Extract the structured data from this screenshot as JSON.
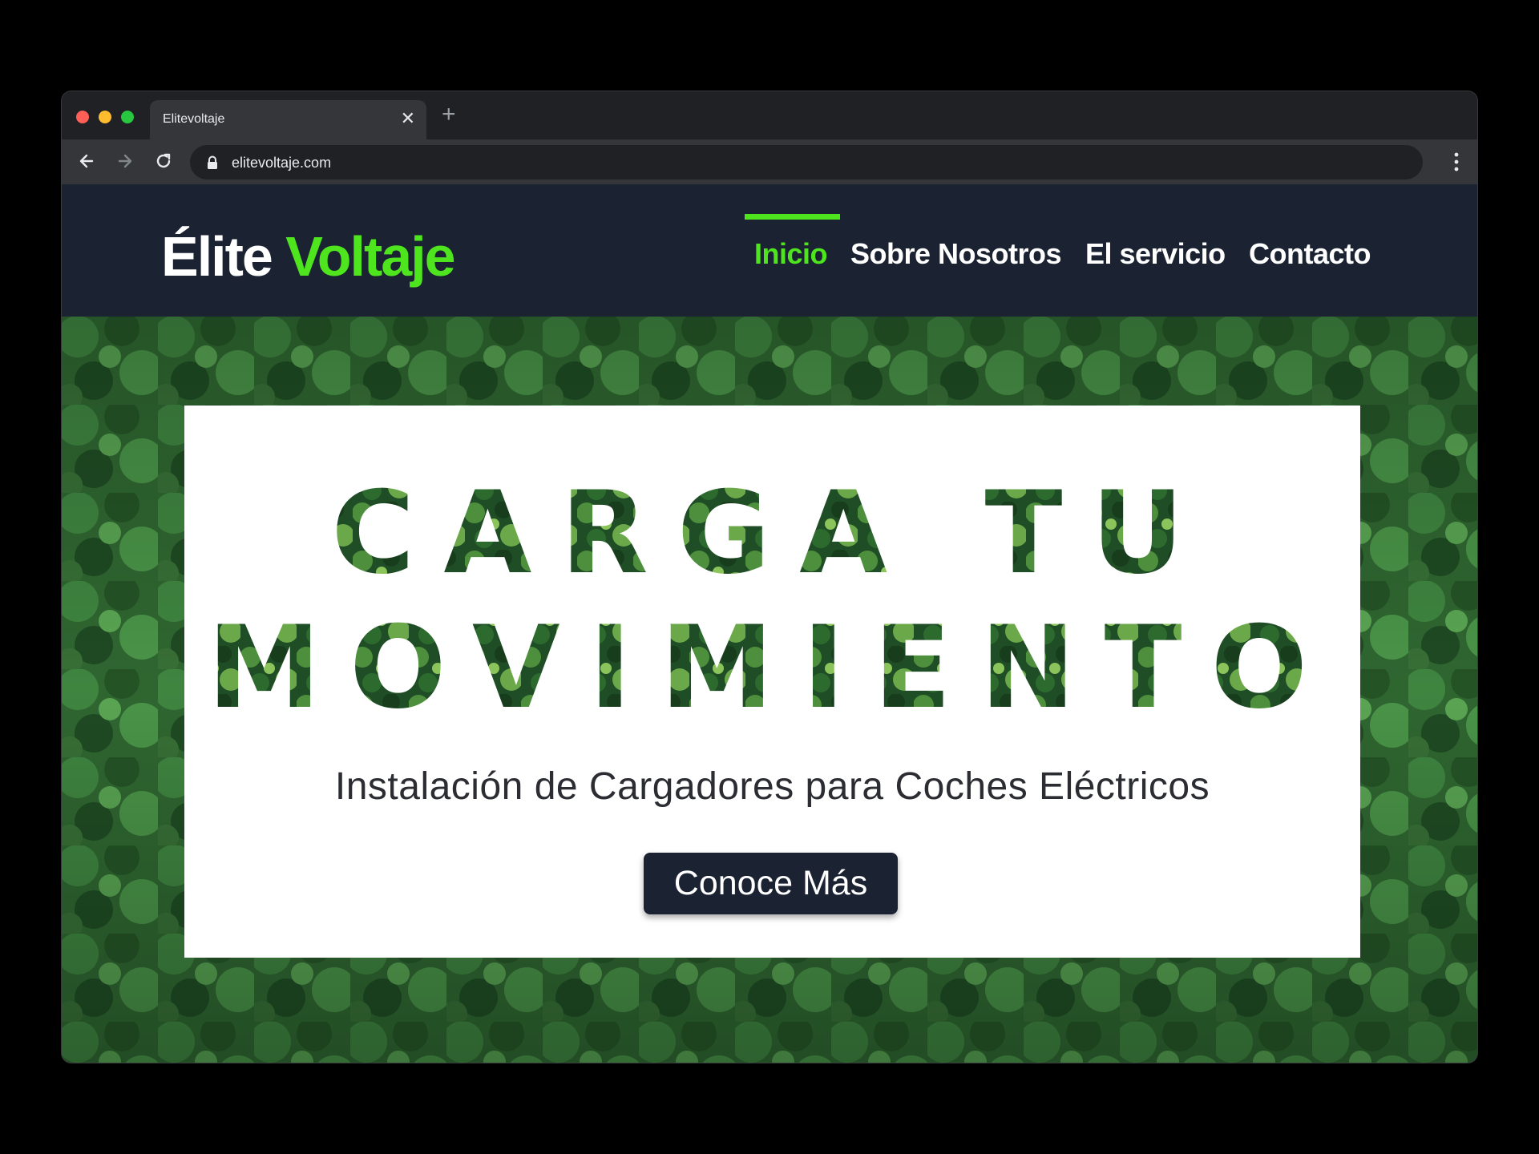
{
  "browser": {
    "tab_title": "Elitevoltaje",
    "url": "elitevoltaje.com",
    "new_tab_symbol": "+",
    "close_symbol": "✕"
  },
  "site": {
    "logo_part1": "Élite",
    "logo_part2": "Voltaje",
    "nav": [
      {
        "label": "Inicio",
        "active": true
      },
      {
        "label": "Sobre Nosotros",
        "active": false
      },
      {
        "label": "El servicio",
        "active": false
      },
      {
        "label": "Contacto",
        "active": false
      }
    ]
  },
  "hero": {
    "title_line1": "CARGA TU",
    "title_line2": "MOVIMIENTO",
    "subtitle": "Instalación de Cargadores para Coches Eléctricos",
    "cta_label": "Conoce Más"
  },
  "colors": {
    "accent": "#4ee51f",
    "header_bg": "#1b2232",
    "button_bg": "#1b2232",
    "forest_dark": "#1f4a22",
    "forest_light": "#5a9a4a"
  },
  "icons": [
    "back-arrow-icon",
    "forward-arrow-icon",
    "reload-icon",
    "lock-icon",
    "more-vert-icon",
    "close-icon",
    "plus-icon"
  ]
}
